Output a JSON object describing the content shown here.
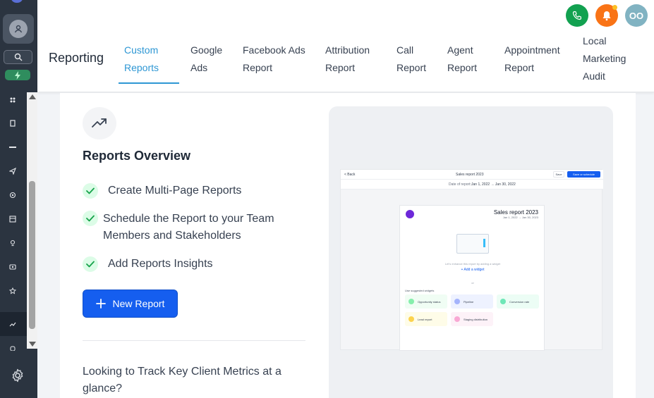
{
  "header": {
    "title": "Reporting",
    "user_initials": "OO",
    "tabs": [
      {
        "line1": "Custom",
        "line2": "Reports",
        "line3": "",
        "active": true
      },
      {
        "line1": "Google",
        "line2": "Ads",
        "line3": "",
        "active": false
      },
      {
        "line1": "Facebook Ads",
        "line2": "Report",
        "line3": "",
        "active": false
      },
      {
        "line1": "Attribution",
        "line2": "Report",
        "line3": "",
        "active": false
      },
      {
        "line1": "Call",
        "line2": "Report",
        "line3": "",
        "active": false
      },
      {
        "line1": "Agent",
        "line2": "Report",
        "line3": "",
        "active": false
      },
      {
        "line1": "Appointment",
        "line2": "Report",
        "line3": "",
        "active": false
      },
      {
        "line1": "Local",
        "line2": "Marketing",
        "line3": "Audit",
        "active": false
      }
    ]
  },
  "overview": {
    "title": "Reports Overview",
    "features": [
      {
        "line1": "Create Multi-Page Reports",
        "line2": ""
      },
      {
        "line1": "Schedule the Report to your Team",
        "line2": "Members and Stakeholders"
      },
      {
        "line1": "Add Reports Insights",
        "line2": ""
      }
    ],
    "new_report_label": "New Report",
    "track_line1": "Looking to Track Key Client Metrics at a",
    "track_line2": "glance?"
  },
  "preview": {
    "back_label": "< Back",
    "report_name": "Sales report 2023",
    "save_label": "Save",
    "save_schedule_label": "Save or schedule",
    "date_label": "Date of report:",
    "date_range": "Jan 1, 2022 → Jan 30, 2022",
    "page_title": "Sales report 2023",
    "page_date": "Jan 1, 2022 → Jan 30, 2023",
    "empty_hint": "Let's enhance this report by adding a widget",
    "add_widget": "+ Add a widget",
    "or": "or",
    "suggested_label": "Use suggested widgets",
    "widgets": [
      {
        "label": "Opportunity status",
        "color": "#dcfce7",
        "dot": "#86efac"
      },
      {
        "label": "Pipeline",
        "color": "#eef2ff",
        "dot": "#a5b4fc"
      },
      {
        "label": "Conversion rate",
        "color": "#ecfdf5",
        "dot": "#6ee7b7"
      },
      {
        "label": "Lead report",
        "color": "#fefce8",
        "dot": "#fcd34d"
      },
      {
        "label": "Staging distribution",
        "color": "#fdf2f8",
        "dot": "#f9a8d4"
      }
    ]
  },
  "colors": {
    "accent": "#2e97d4",
    "primary_button": "#155eef",
    "rail": "#2b3440"
  }
}
